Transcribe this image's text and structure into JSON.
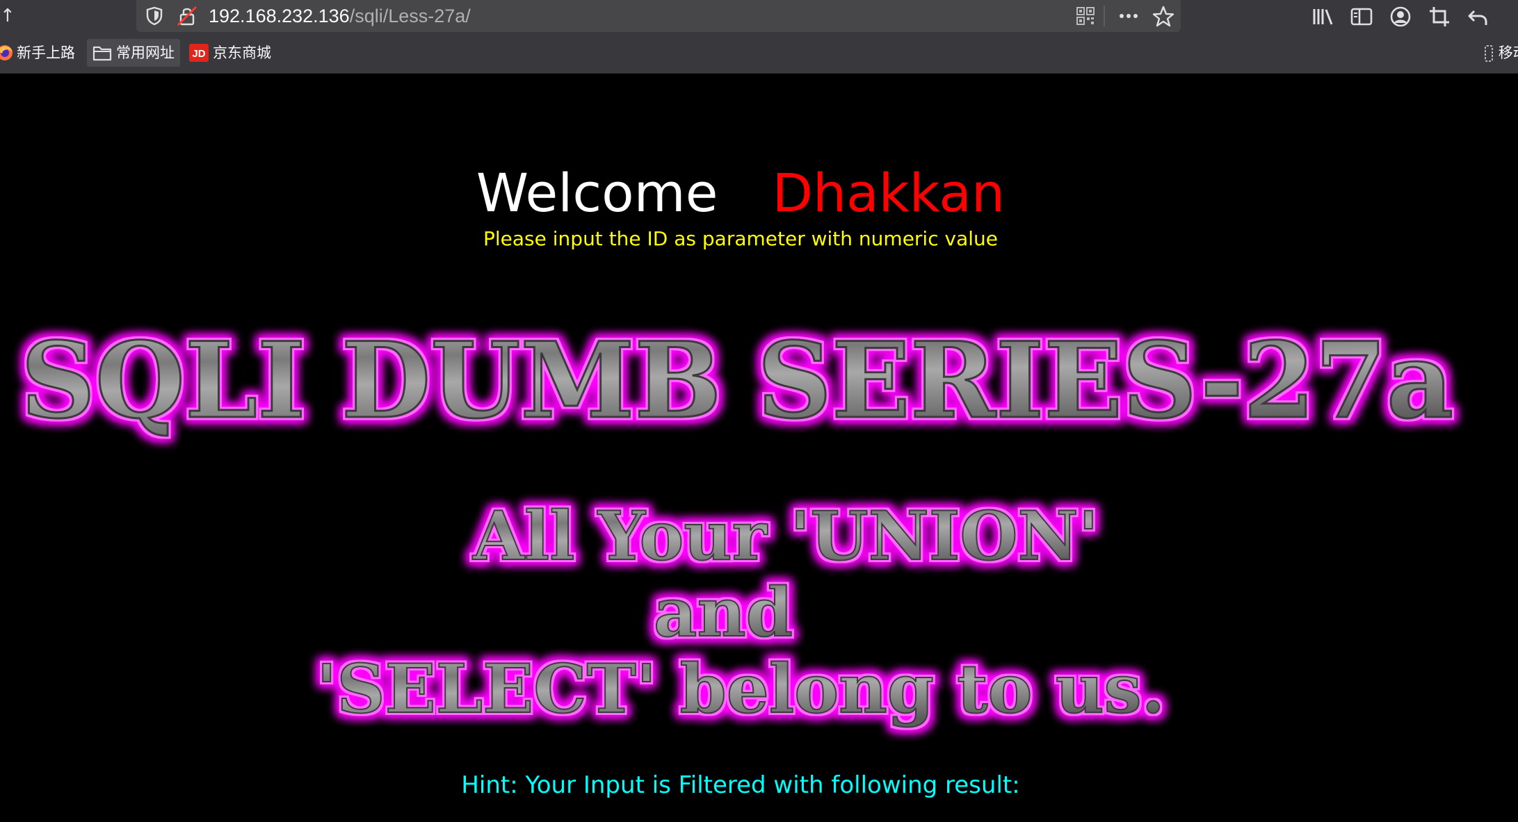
{
  "browser": {
    "url": {
      "host": "192.168.232.136",
      "path": "/sqli/Less-27a/"
    },
    "toolbar_icons": [
      "back-icon",
      "shield-icon",
      "insecure-lock-icon",
      "qr-code-icon",
      "more-actions-icon",
      "bookmark-star-icon",
      "library-icon",
      "sidebar-icon",
      "account-icon",
      "screenshot-icon",
      "undo-icon"
    ],
    "bookmarks": [
      {
        "label": "新手上路",
        "icon": "firefox-icon"
      },
      {
        "label": "常用网址",
        "icon": "folder-icon",
        "active": true
      },
      {
        "label": "京东商城",
        "icon": "jd-icon",
        "badge": "JD"
      }
    ],
    "mobile_bookmarks_label": "移动"
  },
  "page": {
    "welcome": "Welcome",
    "welcome_name": "Dhakkan",
    "prompt": "Please input the ID as parameter with numeric value",
    "banner_title": "SQLI DUMB SERIES-27a",
    "banner_lines": [
      "All Your 'UNION'",
      "and",
      "'SELECT' belong to us."
    ],
    "hint": "Hint: Your Input is Filtered with following result:"
  },
  "colors": {
    "background": "#000000",
    "welcome": "#ffffff",
    "name": "#ff0000",
    "prompt": "#ffff00",
    "hint": "#00ffff",
    "banner_glow": "#ff00ff",
    "banner_fill": "#8a8a8a"
  }
}
